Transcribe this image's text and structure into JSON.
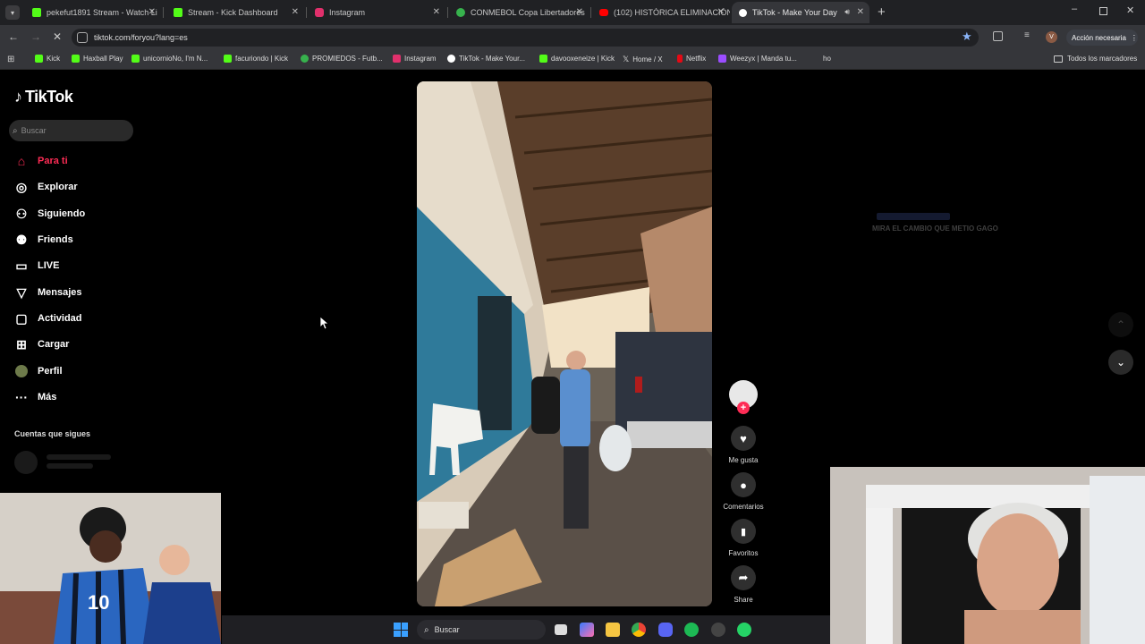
{
  "browser": {
    "tabs": [
      {
        "label": "pekefut1891 Stream - Watch Li",
        "favicon": "kick-icon",
        "color": "#53fc18"
      },
      {
        "label": "Stream - Kick Dashboard",
        "favicon": "kick-icon",
        "color": "#53fc18"
      },
      {
        "label": "Instagram",
        "favicon": "instagram-icon",
        "color": "#e1306c"
      },
      {
        "label": "CONMEBOL Copa Libertadores",
        "favicon": "conmebol-icon",
        "color": "#37b24d"
      },
      {
        "label": "(102) HISTÓRICA ELIMINACIÓN",
        "favicon": "youtube-icon",
        "color": "#ff0000"
      },
      {
        "label": "TikTok - Make Your Day",
        "favicon": "tiktok-icon",
        "color": "#ffffff"
      }
    ],
    "url": "tiktok.com/foryou?lang=es",
    "action_needed": "Acción necesaria",
    "profile_initial": "V",
    "bookmarks": [
      {
        "label": "Kick",
        "color": "#53fc18"
      },
      {
        "label": "Haxball Play",
        "color": "#53fc18"
      },
      {
        "label": "unicornioNo, I'm N...",
        "color": "#53fc18"
      },
      {
        "label": "facuriondo | Kick",
        "color": "#53fc18"
      },
      {
        "label": "PROMIEDOS - Futb...",
        "color": "#37b24d"
      },
      {
        "label": "Instagram",
        "color": "#e1306c"
      },
      {
        "label": "TikTok - Make Your...",
        "color": "#ffffff"
      },
      {
        "label": "davooxeneize | Kick",
        "color": "#53fc18"
      },
      {
        "label": "Home / X",
        "color": "#ffffff"
      },
      {
        "label": "Netflix",
        "color": "#e50914"
      },
      {
        "label": "Weezyx | Manda tu...",
        "color": "#9b4dff"
      },
      {
        "label": "ho",
        "color": ""
      }
    ],
    "all_bookmarks": "Todos los marcadores"
  },
  "tiktok": {
    "logo": "TikTok",
    "search_placeholder": "Buscar",
    "nav": [
      {
        "label": "Para ti",
        "icon": "home-icon",
        "active": true
      },
      {
        "label": "Explorar",
        "icon": "compass-icon"
      },
      {
        "label": "Siguiendo",
        "icon": "following-icon"
      },
      {
        "label": "Friends",
        "icon": "friends-icon"
      },
      {
        "label": "LIVE",
        "icon": "live-icon"
      },
      {
        "label": "Mensajes",
        "icon": "messages-icon"
      },
      {
        "label": "Actividad",
        "icon": "activity-icon"
      },
      {
        "label": "Cargar",
        "icon": "upload-icon"
      },
      {
        "label": "Perfil",
        "icon": "avatar"
      },
      {
        "label": "Más",
        "icon": "more-icon"
      }
    ],
    "following_heading": "Cuentas que sigues",
    "actions": {
      "like": "Me gusta",
      "comments": "Comentarios",
      "favorites": "Favoritos",
      "share": "Share"
    },
    "overlay_caption": "MIRA EL CAMBIO QUE METIO GAGO"
  },
  "taskbar": {
    "search_label": "Buscar"
  },
  "colors": {
    "accent": "#fe2c55"
  }
}
